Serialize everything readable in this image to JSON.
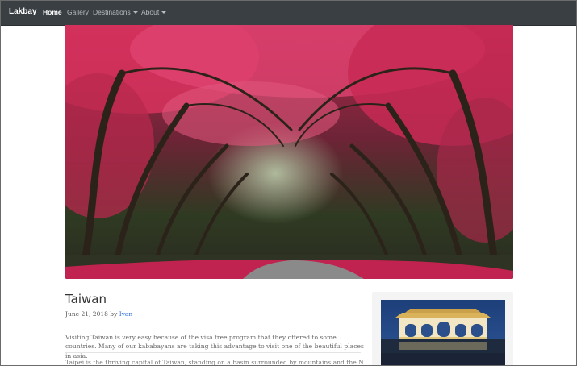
{
  "navbar": {
    "brand": "Lakbay",
    "items": [
      {
        "label": "Home",
        "active": true,
        "dropdown": false
      },
      {
        "label": "Gallery",
        "active": false,
        "dropdown": false
      },
      {
        "label": "Destinations",
        "active": false,
        "dropdown": true
      },
      {
        "label": "About",
        "active": false,
        "dropdown": true
      }
    ]
  },
  "post": {
    "title": "Taiwan",
    "date": "June 21, 2018 by",
    "author": "Ivan",
    "excerpt": "Visiting Taiwan is very easy because of the visa free program that they offered to some countries. Many of our kababayans are taking this advantage to visit one of the beautiful places in asia.",
    "second_paragraph": "Taipei is the thriving capital of Taiwan, standing on a basin surrounded by mountains and the New"
  },
  "colors": {
    "navbar_bg": "#3a3f44",
    "link": "#2a6fdb",
    "blossom": "#d8325e"
  },
  "images": {
    "hero": "cherry-blossom-tree-tunnel-photo",
    "sidebar_thumb": "memorial-gate-night-photo"
  }
}
